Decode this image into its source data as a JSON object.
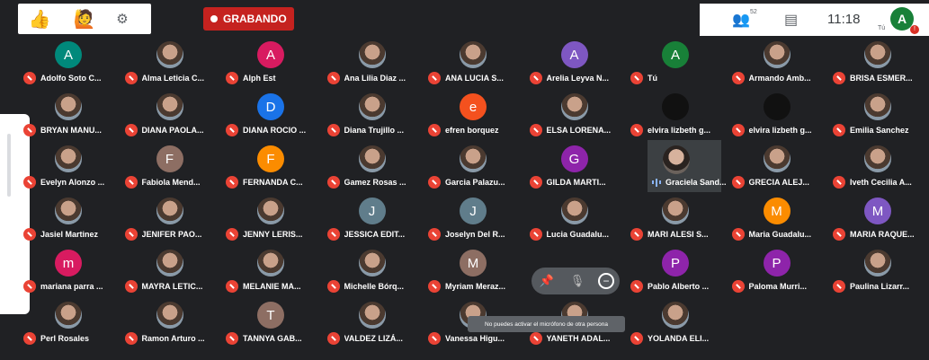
{
  "toolbar": {
    "recording_label": "GRABANDO",
    "participants_count": "52",
    "clock": "11:18",
    "me_initial": "A",
    "me_sub": "Tú",
    "notification": "!"
  },
  "colors": {
    "recording": "#c5221f",
    "mic_off": "#ea4335",
    "teal": "#00897b",
    "pink": "#d81b60",
    "blue": "#1a73e8",
    "orange": "#f4511e",
    "purple": "#8e24aa",
    "green": "#188038",
    "grey": "#607d8b",
    "taupe": "#8d6e63",
    "amber": "#fb8c00",
    "violet": "#7e57c2"
  },
  "participants": [
    [
      {
        "name": "Adolfo Soto C...",
        "initial": "A",
        "color": "#00897b"
      },
      {
        "name": "Alma Leticia C...",
        "photo": true
      },
      {
        "name": "Alph Est",
        "initial": "A",
        "color": "#d81b60"
      },
      {
        "name": "Ana Lilia Diaz ...",
        "photo": true
      },
      {
        "name": "ANA LUCIA S...",
        "photo": true
      },
      {
        "name": "Arelia Leyva N...",
        "initial": "A",
        "color": "#7e57c2"
      },
      {
        "name": "Tú",
        "initial": "A",
        "color": "#188038"
      },
      {
        "name": "Armando Amb...",
        "photo": true
      },
      {
        "name": "BRISA ESMER...",
        "photo": true
      }
    ],
    [
      {
        "name": "BRYAN MANU...",
        "photo": true
      },
      {
        "name": "DIANA PAOLA...",
        "photo": true
      },
      {
        "name": "DIANA ROCIO ...",
        "initial": "D",
        "color": "#1a73e8"
      },
      {
        "name": "Diana Trujillo ...",
        "photo": true
      },
      {
        "name": "efren borquez",
        "initial": "e",
        "color": "#f4511e"
      },
      {
        "name": "ELSA LORENA...",
        "photo": true
      },
      {
        "name": "elvira lizbeth g...",
        "dark": true
      },
      {
        "name": "elvira lizbeth g...",
        "dark": true
      },
      {
        "name": "Emilia Sanchez",
        "photo": true
      }
    ],
    [
      {
        "name": "Evelyn Alonzo ...",
        "photo": true
      },
      {
        "name": "Fabiola Mend...",
        "initial": "F",
        "color": "#8d6e63"
      },
      {
        "name": "FERNANDA C...",
        "initial": "F",
        "color": "#fb8c00"
      },
      {
        "name": "Gamez Rosas ...",
        "photo": true
      },
      {
        "name": "Garcia Palazu...",
        "photo": true
      },
      {
        "name": "GILDA MARTI...",
        "initial": "G",
        "color": "#8e24aa"
      },
      {
        "name": "Graciela Sand...",
        "video": true
      },
      {
        "name": "GRECIA ALEJ...",
        "photo": true
      },
      {
        "name": "Iveth Cecilia A...",
        "photo": true
      }
    ],
    [
      {
        "name": "Jasiel Martinez",
        "photo": true
      },
      {
        "name": "JENIFER PAO...",
        "photo": true
      },
      {
        "name": "JENNY LERIS...",
        "photo": true
      },
      {
        "name": "JESSICA EDIT...",
        "initial": "J",
        "color": "#607d8b"
      },
      {
        "name": "Joselyn Del R...",
        "initial": "J",
        "color": "#607d8b"
      },
      {
        "name": "Lucia Guadalu...",
        "photo": true
      },
      {
        "name": "MARI ALESI S...",
        "photo": true
      },
      {
        "name": "Maria Guadalu...",
        "initial": "M",
        "color": "#fb8c00"
      },
      {
        "name": "MARIA RAQUE...",
        "initial": "M",
        "color": "#7e57c2"
      }
    ],
    [
      {
        "name": "mariana parra ...",
        "initial": "m",
        "color": "#d81b60"
      },
      {
        "name": "MAYRA LETIC...",
        "photo": true
      },
      {
        "name": "MELANIE MA...",
        "photo": true
      },
      {
        "name": "Michelle Bórq...",
        "photo": true
      },
      {
        "name": "Myriam Meraz...",
        "initial": "M",
        "color": "#8d6e63"
      },
      {
        "name": "",
        "hidden": true
      },
      {
        "name": "Pablo Alberto ...",
        "initial": "P",
        "color": "#8e24aa"
      },
      {
        "name": "Paloma Murri...",
        "initial": "P",
        "color": "#8e24aa"
      },
      {
        "name": "Paulina Lizarr...",
        "photo": true
      }
    ],
    [
      {
        "name": "Perl Rosales",
        "photo": true
      },
      {
        "name": "Ramon Arturo ...",
        "photo": true
      },
      {
        "name": "TANNYA GAB...",
        "initial": "T",
        "color": "#8d6e63"
      },
      {
        "name": "VALDEZ LIZÁ...",
        "photo": true
      },
      {
        "name": "Vanessa Higu...",
        "photo": true
      },
      {
        "name": "YANETH ADAL...",
        "photo": true
      },
      {
        "name": "YOLANDA ELI...",
        "photo": true
      }
    ]
  ],
  "tile_menu": {
    "pin_icon": "pin-icon",
    "mute_icon": "mic-off-icon",
    "remove_icon": "remove-icon"
  },
  "tooltip": "No puedes activar el micrófono de otra persona"
}
